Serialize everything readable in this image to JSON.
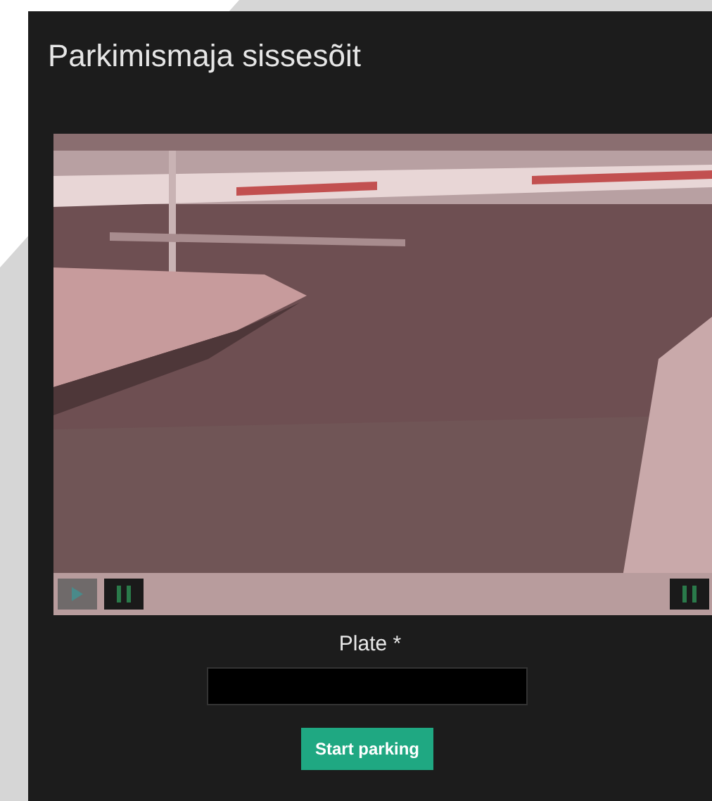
{
  "dialog": {
    "title": "Parkimismaja sissesõit"
  },
  "video": {
    "playing": false
  },
  "plate": {
    "label": "Plate *"
  },
  "buttons": [
    {
      "label": "Start parking"
    }
  ]
}
